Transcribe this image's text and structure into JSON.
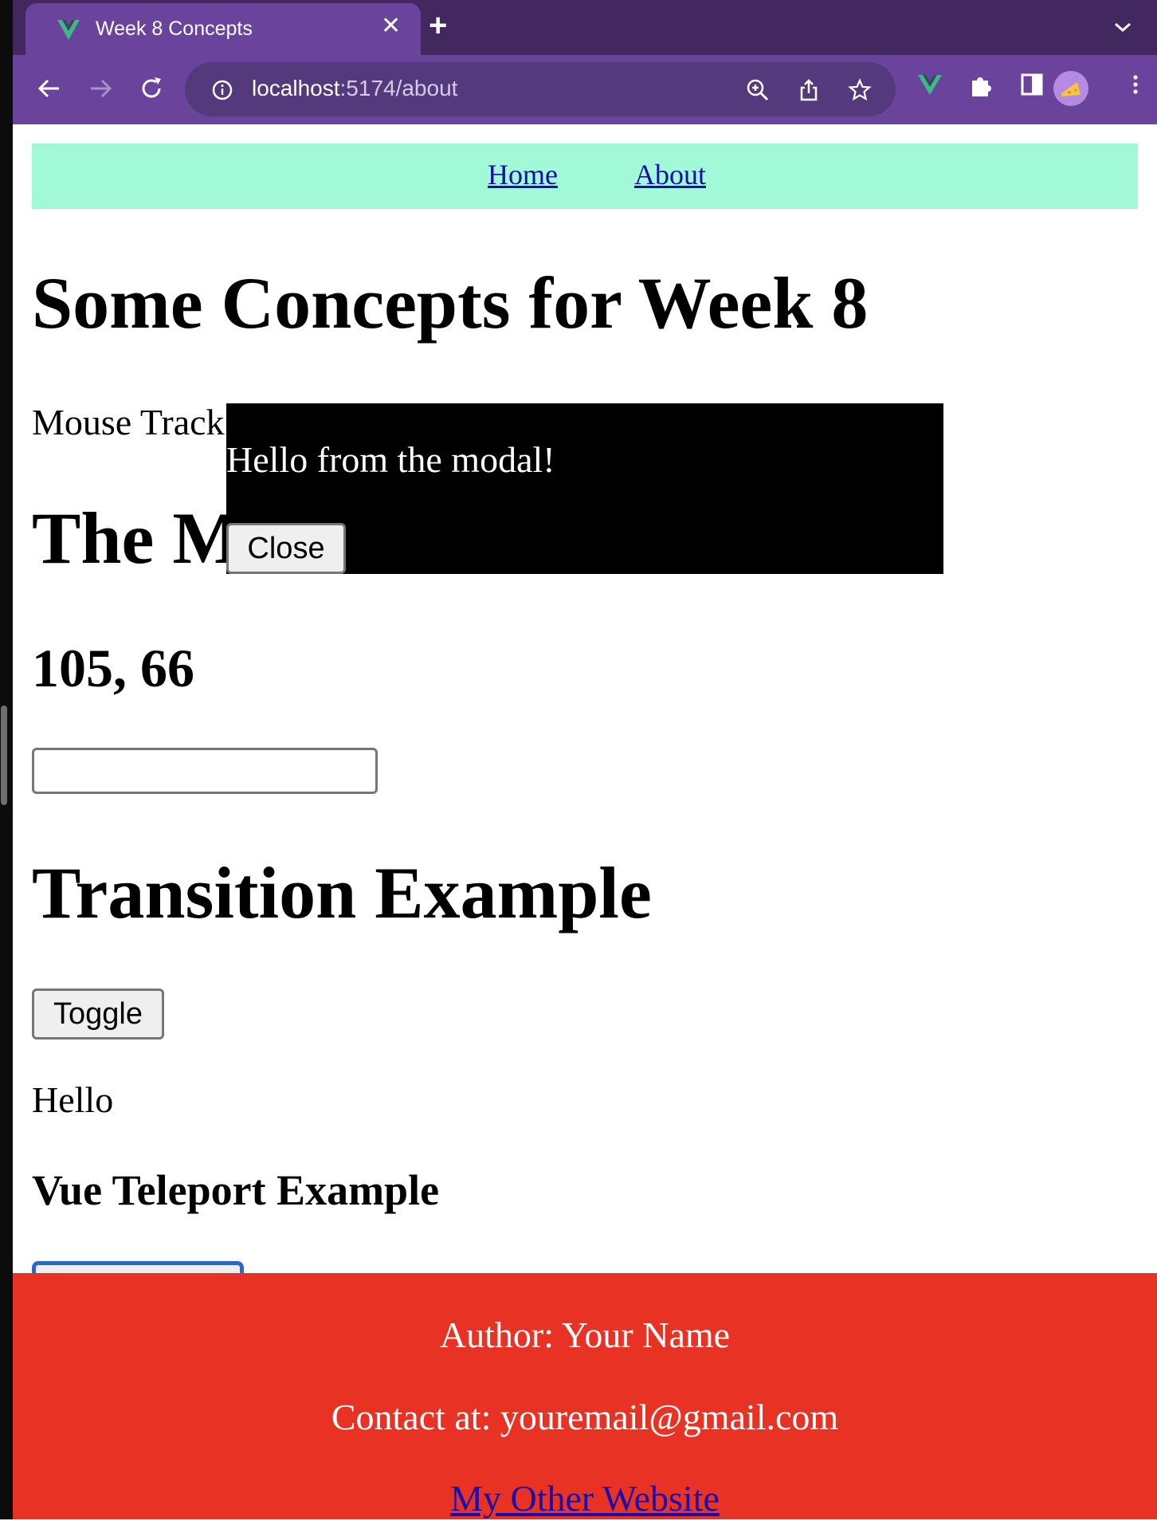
{
  "browser": {
    "tab_title": "Week 8 Concepts",
    "url_host": "localhost",
    "url_path": ":5174/about",
    "colors": {
      "tabbar": "#42285f",
      "toolbar": "#6a439d",
      "omnibox": "#543a7d",
      "vue_green": "#41b883"
    }
  },
  "nav": {
    "home": "Home",
    "about": "About"
  },
  "main": {
    "title": "Some Concepts for Week 8",
    "mouse_label": "Mouse Track",
    "mouse_heading": "The M",
    "coords": "105, 66",
    "input_value": "",
    "transition_heading": "Transition Example",
    "toggle_label": "Toggle",
    "hello": "Hello",
    "teleport_heading": "Vue Teleport Example"
  },
  "modal": {
    "text": "Hello from the modal!",
    "close_label": "Close"
  },
  "footer": {
    "author": "Author: Your Name",
    "contact": "Contact at: youremail@gmail.com",
    "link": "My Other Website",
    "color": "#e83324"
  }
}
